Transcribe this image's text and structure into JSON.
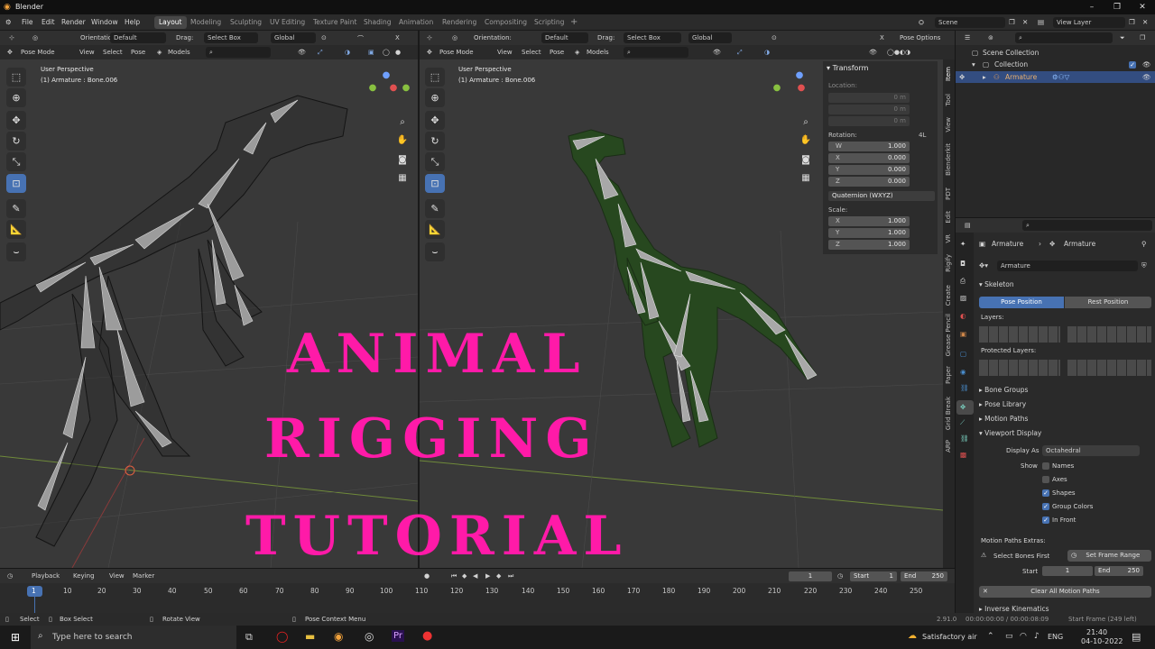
{
  "app": {
    "title": "Blender"
  },
  "window_controls": [
    "–",
    "❐",
    "✕"
  ],
  "menu": [
    "File",
    "Edit",
    "Render",
    "Window",
    "Help"
  ],
  "workspaces": [
    "Layout",
    "Modeling",
    "Sculpting",
    "UV Editing",
    "Texture Paint",
    "Shading",
    "Animation",
    "Rendering",
    "Compositing",
    "Scripting",
    "+"
  ],
  "scene": {
    "name": "Scene",
    "view_layer": "View Layer"
  },
  "toolheader": {
    "orientation_label": "Orientation:",
    "orientation_value": "Default",
    "drag_label": "Drag:",
    "drag_value": "Select Box",
    "transform": "Global",
    "pose_options": "Pose Options"
  },
  "viewport_header": {
    "mode": "Pose Mode",
    "menus": [
      "View",
      "Select",
      "Pose"
    ],
    "models": "Models"
  },
  "viewport_left": {
    "perspective": "User Perspective",
    "object": "(1) Armature : Bone.006"
  },
  "viewport_right": {
    "perspective": "User Perspective",
    "object": "(1) Armature : Bone.006"
  },
  "npanel": {
    "title": "Transform",
    "location_label": "Location:",
    "location": [
      {
        "axis": "X",
        "value": "0 m"
      },
      {
        "axis": "Y",
        "value": "0 m"
      },
      {
        "axis": "Z",
        "value": "0 m"
      }
    ],
    "rotation_label": "Rotation:",
    "rotation_mode_short": "4L",
    "rotation": [
      {
        "axis": "W",
        "value": "1.000"
      },
      {
        "axis": "X",
        "value": "0.000"
      },
      {
        "axis": "Y",
        "value": "0.000"
      },
      {
        "axis": "Z",
        "value": "0.000"
      }
    ],
    "rotation_mode": "Quaternion (WXYZ)",
    "scale_label": "Scale:",
    "scale": [
      {
        "axis": "X",
        "value": "1.000"
      },
      {
        "axis": "Y",
        "value": "1.000"
      },
      {
        "axis": "Z",
        "value": "1.000"
      }
    ],
    "tabs": [
      "Item",
      "Tool",
      "View",
      "Blenderkit",
      "PDT",
      "Edit",
      "VR",
      "Rigify",
      "Create",
      "Grease Pencil",
      "Paper",
      "Grid Break",
      "ARP"
    ]
  },
  "outliner": {
    "scene_collection": "Scene Collection",
    "collection": "Collection",
    "armature": "Armature"
  },
  "properties": {
    "breadcrumb_object": "Armature",
    "breadcrumb_data": "Armature",
    "data_name": "Armature",
    "skeleton": "Skeleton",
    "pose_position": "Pose Position",
    "rest_position": "Rest Position",
    "layers_label": "Layers:",
    "protected_layers_label": "Protected Layers:",
    "panels": [
      "Bone Groups",
      "Pose Library",
      "Motion Paths"
    ],
    "viewport_display": "Viewport Display",
    "display_as_label": "Display As",
    "display_as_value": "Octahedral",
    "show_label": "Show",
    "show_options": [
      {
        "label": "Names",
        "checked": false
      },
      {
        "label": "Axes",
        "checked": false
      },
      {
        "label": "Shapes",
        "checked": true
      },
      {
        "label": "Group Colors",
        "checked": true
      },
      {
        "label": "In Front",
        "checked": true
      }
    ],
    "motion_paths_extras": "Motion Paths Extras:",
    "select_bones_first": "Select Bones First",
    "set_frame_range": "Set Frame Range",
    "start_label": "Start",
    "start_value": "1",
    "end_label": "End",
    "end_value": "250",
    "clear_motion_paths": "Clear All Motion Paths",
    "inverse_kinematics": "Inverse Kinematics"
  },
  "timeline": {
    "menus": [
      "Playback",
      "Keying",
      "View",
      "Marker"
    ],
    "current_frame": "1",
    "start_label": "Start",
    "start": "1",
    "end_label": "End",
    "end": "250",
    "ticks": [
      "1",
      "10",
      "20",
      "30",
      "40",
      "50",
      "60",
      "70",
      "80",
      "90",
      "100",
      "110",
      "120",
      "130",
      "140",
      "150",
      "160",
      "170",
      "180",
      "190",
      "200",
      "210",
      "220",
      "230",
      "240",
      "250"
    ]
  },
  "statusbar": {
    "items": [
      "Select",
      "Box Select",
      "Rotate View",
      "Pose Context Menu"
    ],
    "version": "2.91.0",
    "time": "00:00:00:00 / 00:00:08:09",
    "start_frame": "Start Frame (249 left)"
  },
  "overlay_title": [
    "ANIMAL",
    "RIGGING",
    "TUTORIAL"
  ],
  "taskbar": {
    "search": "Type here to search",
    "weather": "Satisfactory air",
    "lang": "ENG",
    "time": "21:40",
    "date": "04-10-2022"
  },
  "colors": {
    "accent": "#4772b3",
    "overlay_text": "#ff1aa8",
    "viewport_bg": "#393939"
  }
}
